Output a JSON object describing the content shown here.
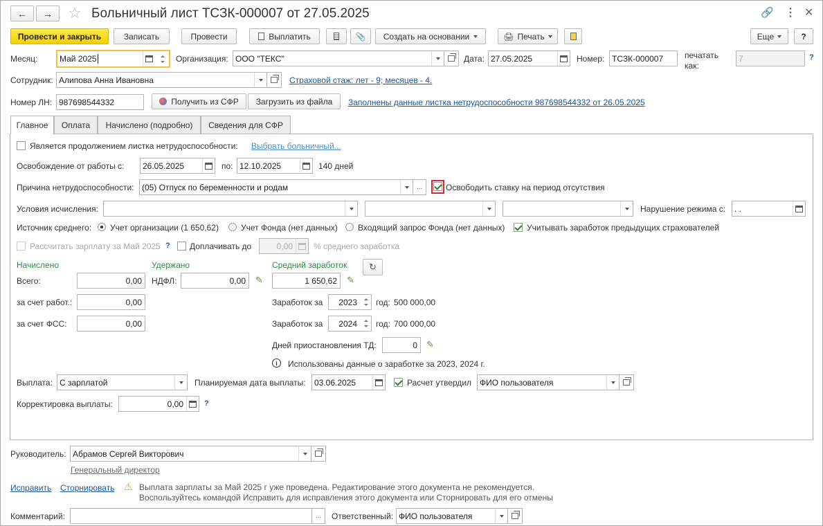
{
  "title": "Больничный лист ТСЗК-000007 от 27.05.2025",
  "toolbar": {
    "post_close": "Провести и закрыть",
    "save": "Записать",
    "post": "Провести",
    "pay": "Выплатить",
    "create_based": "Создать на основании",
    "print": "Печать",
    "more": "Еще",
    "help": "?"
  },
  "header": {
    "month_label": "Месяц:",
    "month_value": "Май 2025",
    "org_label": "Организация:",
    "org_value": "ООО \"ТЕКС\"",
    "date_label": "Дата:",
    "date_value": "27.05.2025",
    "number_label": "Номер:",
    "number_value": "ТСЗК-000007",
    "print_as_label": "печатать как:",
    "print_as_value": "7",
    "print_as_help": "?",
    "employee_label": "Сотрудник:",
    "employee_value": "Алипова Анна Ивановна",
    "insurance_link": "Страховой стаж: лет - 9; месяцев - 4.",
    "ln_label": "Номер ЛН:",
    "ln_value": "987698544332",
    "get_sfr": "Получить из СФР",
    "load_file": "Загрузить из файла",
    "filled_link": "Заполнены данные листка нетрудоспособности 987698544332 от 26.05.2025"
  },
  "tabs": [
    "Главное",
    "Оплата",
    "Начислено (подробно)",
    "Сведения для СФР"
  ],
  "main": {
    "continuation_label": "Является продолжением листка нетрудоспособности:",
    "choose_sick_link": "Выбрать больничный...",
    "release_label": "Освобождение от работы с:",
    "release_from": "26.05.2025",
    "to_label": "по:",
    "release_to": "12.10.2025",
    "days": "140 дней",
    "reason_label": "Причина нетрудоспособности:",
    "reason_value": "(05) Отпуск по беременности и родам",
    "free_rate_label": "Освободить ставку на период отсутствия",
    "conditions_label": "Условия исчисления:",
    "violation_label": "Нарушение режима с:",
    "violation_value": " .  .",
    "source_label": "Источник среднего:",
    "source_org": "Учет организации (1 650,62)",
    "source_fund": "Учет Фонда (нет данных)",
    "source_request": "Входящий запрос Фонда (нет данных)",
    "prev_insurers": "Учитывать заработок предыдущих страхователей",
    "calc_salary": "Рассчитать зарплату за Май 2025",
    "calc_help": "?",
    "topup_label": "Доплачивать до",
    "topup_value": "0,00",
    "topup_suffix": "% среднего заработка",
    "accrued_header": "Начислено",
    "total_label": "Всего:",
    "total_value": "0,00",
    "employer_label": "за счет работ.:",
    "employer_value": "0,00",
    "fss_label": "за счет ФСС:",
    "fss_value": "0,00",
    "withheld_header": "Удержано",
    "ndfl_label": "НДФЛ:",
    "ndfl_value": "0,00",
    "avg_header": "Средний заработок",
    "avg_value": "1 650,62",
    "earn1_label": "Заработок за",
    "earn1_year": "2023",
    "earn1_year_label": "год:",
    "earn1_value": "500 000,00",
    "earn2_label": "Заработок за",
    "earn2_year": "2024",
    "earn2_year_label": "год:",
    "earn2_value": "700 000,00",
    "suspension_label": "Дней приостановления ТД:",
    "suspension_value": "0",
    "info_text": "Использованы данные о заработке за  2023,  2024 г.",
    "payout_label": "Выплата:",
    "payout_value": "С зарплатой",
    "planned_label": "Планируемая дата выплаты:",
    "planned_value": "03.06.2025",
    "approved_label": "Расчет утвердил",
    "approved_value": "ФИО пользователя",
    "correction_label": "Корректировка выплаты:",
    "correction_value": "0,00",
    "correction_help": "?"
  },
  "footer": {
    "manager_label": "Руководитель:",
    "manager_value": "Абрамов Сергей Викторович",
    "manager_position": "Генеральный директор",
    "fix_link": "Исправить",
    "reverse_link": "Сторнировать",
    "warning_line1": "Выплата зарплаты за Май 2025 г уже проведена. Редактирование этого документа не рекомендуется.",
    "warning_line2": "Воспользуйтесь командой Исправить для исправления этого документа или Сторнировать для его отмены",
    "comment_label": "Комментарий:",
    "responsible_label": "Ответственный:",
    "responsible_value": "ФИО пользователя"
  }
}
